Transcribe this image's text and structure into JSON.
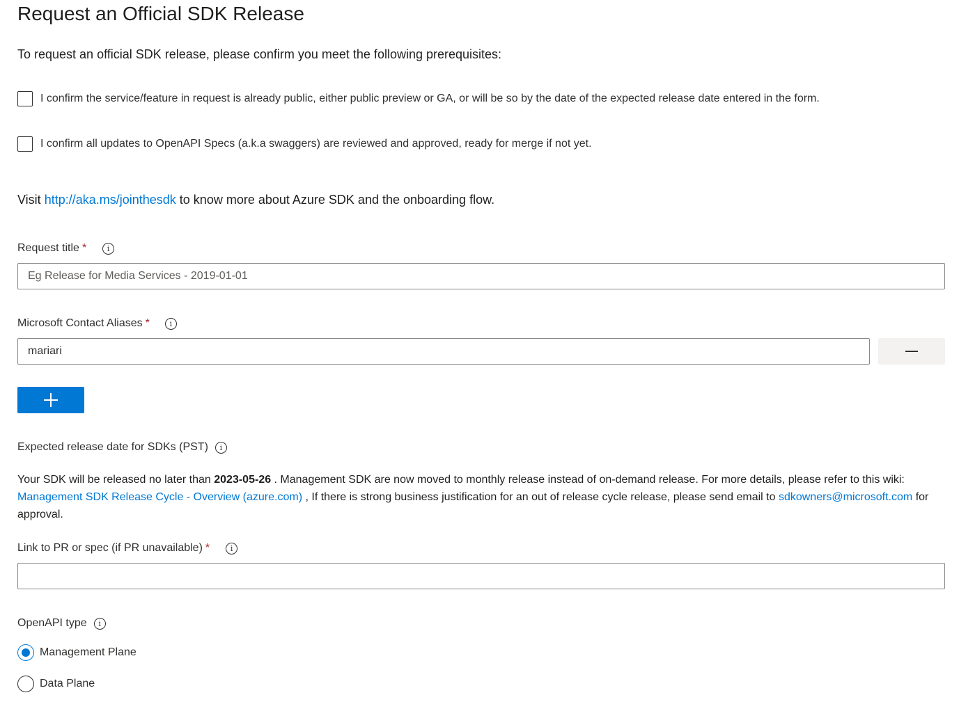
{
  "page": {
    "title": "Request an Official SDK Release",
    "intro": "To request an official SDK release, please confirm you meet the following prerequisites:"
  },
  "prerequisites": [
    {
      "label": "I confirm the service/feature in request is already public, either public preview or GA, or will be so by the date of the expected release date entered in the form.",
      "checked": false
    },
    {
      "label": "I confirm all updates to OpenAPI Specs (a.k.a swaggers) are reviewed and approved, ready for merge if not yet.",
      "checked": false
    }
  ],
  "visit": {
    "prefix": "Visit ",
    "link_text": "http://aka.ms/jointhesdk",
    "suffix": " to know more about Azure SDK and the onboarding flow."
  },
  "request_title": {
    "label": "Request title",
    "required_mark": "*",
    "placeholder": "Eg Release for Media Services - 2019-01-01",
    "value": ""
  },
  "contact_aliases": {
    "label": "Microsoft Contact Aliases",
    "required_mark": "*",
    "value": "mariari"
  },
  "release_date": {
    "label": "Expected release date for SDKs (PST)",
    "text_before": "Your SDK will be released no later than ",
    "date": "2023-05-26",
    "text_after": " . Management SDK are now moved to monthly release instead of on-demand release. For more details, please refer to this wiki: ",
    "wiki_link": "Management SDK Release Cycle - Overview (azure.com)",
    "text_middle": " , If there is strong business justification for an out of release cycle release, please send email to ",
    "email_link": "sdkowners@microsoft.com",
    "text_end": " for approval."
  },
  "pr_link": {
    "label": "Link to PR or spec (if PR unavailable)",
    "required_mark": "*",
    "value": ""
  },
  "openapi_type": {
    "label": "OpenAPI type",
    "options": [
      {
        "label": "Management Plane",
        "selected": true
      },
      {
        "label": "Data Plane",
        "selected": false
      }
    ]
  },
  "icons": {
    "info": "info-icon",
    "info_glyph": "i",
    "add": "plus-icon",
    "remove": "minus-icon"
  },
  "colors": {
    "accent": "#0078d4",
    "required": "#a4262c",
    "text": "#201f1e",
    "border": "#8a8886",
    "secondary_button_bg": "#f3f2f1"
  }
}
